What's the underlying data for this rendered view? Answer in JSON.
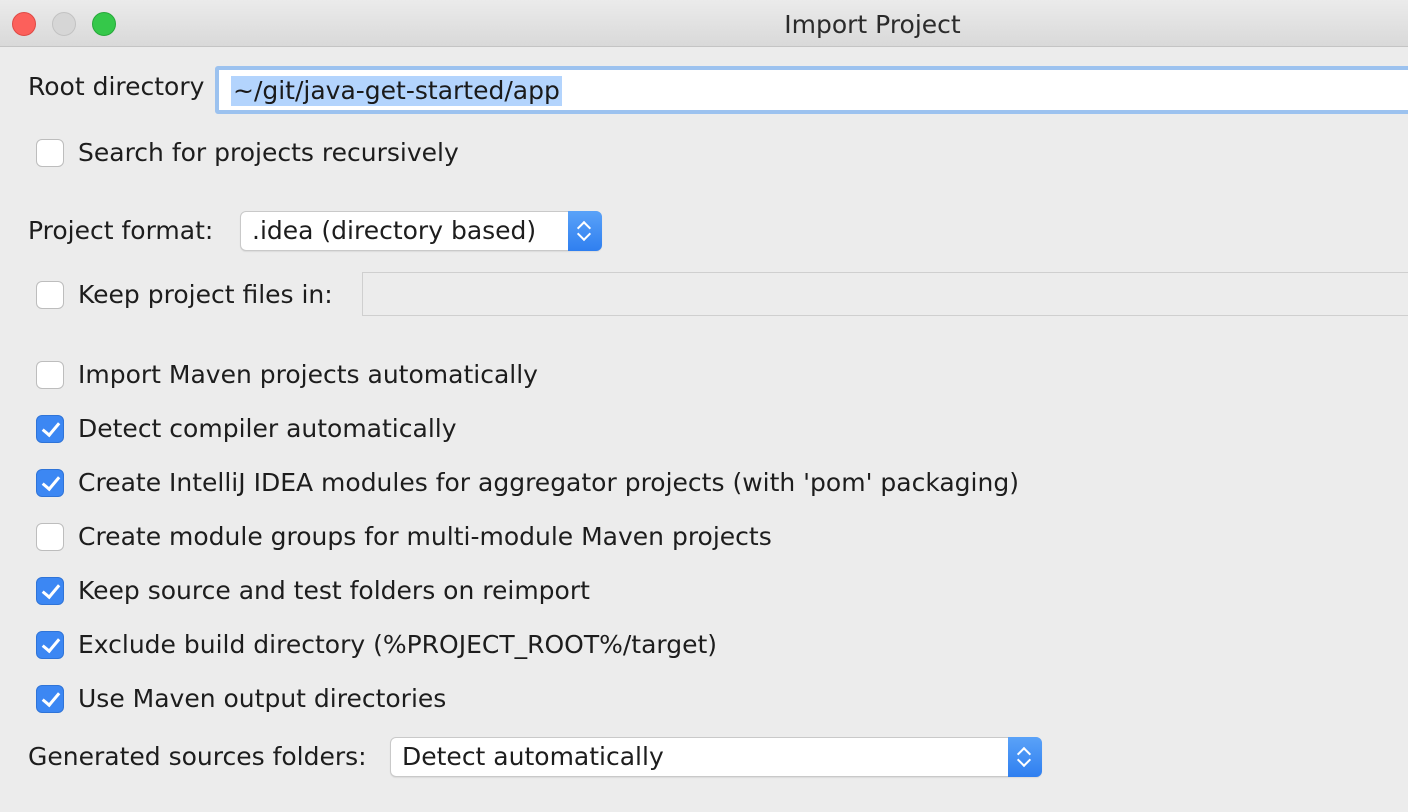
{
  "window": {
    "title": "Import Project"
  },
  "root_directory": {
    "label": "Root directory",
    "value": "~/git/java-get-started/app"
  },
  "search_recursively": {
    "label": "Search for projects recursively",
    "checked": false
  },
  "project_format": {
    "label": "Project format:",
    "selected": ".idea (directory based)"
  },
  "keep_project_files": {
    "label": "Keep project files in:",
    "checked": false,
    "value": ""
  },
  "options": [
    {
      "label": "Import Maven projects automatically",
      "checked": false
    },
    {
      "label": "Detect compiler automatically",
      "checked": true
    },
    {
      "label": "Create IntelliJ IDEA modules for aggregator projects (with 'pom' packaging)",
      "checked": true
    },
    {
      "label": "Create module groups for multi-module Maven projects",
      "checked": false
    },
    {
      "label": "Keep source and test folders on reimport",
      "checked": true
    },
    {
      "label": "Exclude build directory (%PROJECT_ROOT%/target)",
      "checked": true
    },
    {
      "label": "Use Maven output directories",
      "checked": true
    }
  ],
  "generated_sources": {
    "label": "Generated sources folders:",
    "selected": "Detect automatically"
  },
  "colors": {
    "checkbox_checked": "#3c87f3",
    "selection_highlight": "#b3d4fd",
    "focus_ring": "#9cc2ef"
  }
}
